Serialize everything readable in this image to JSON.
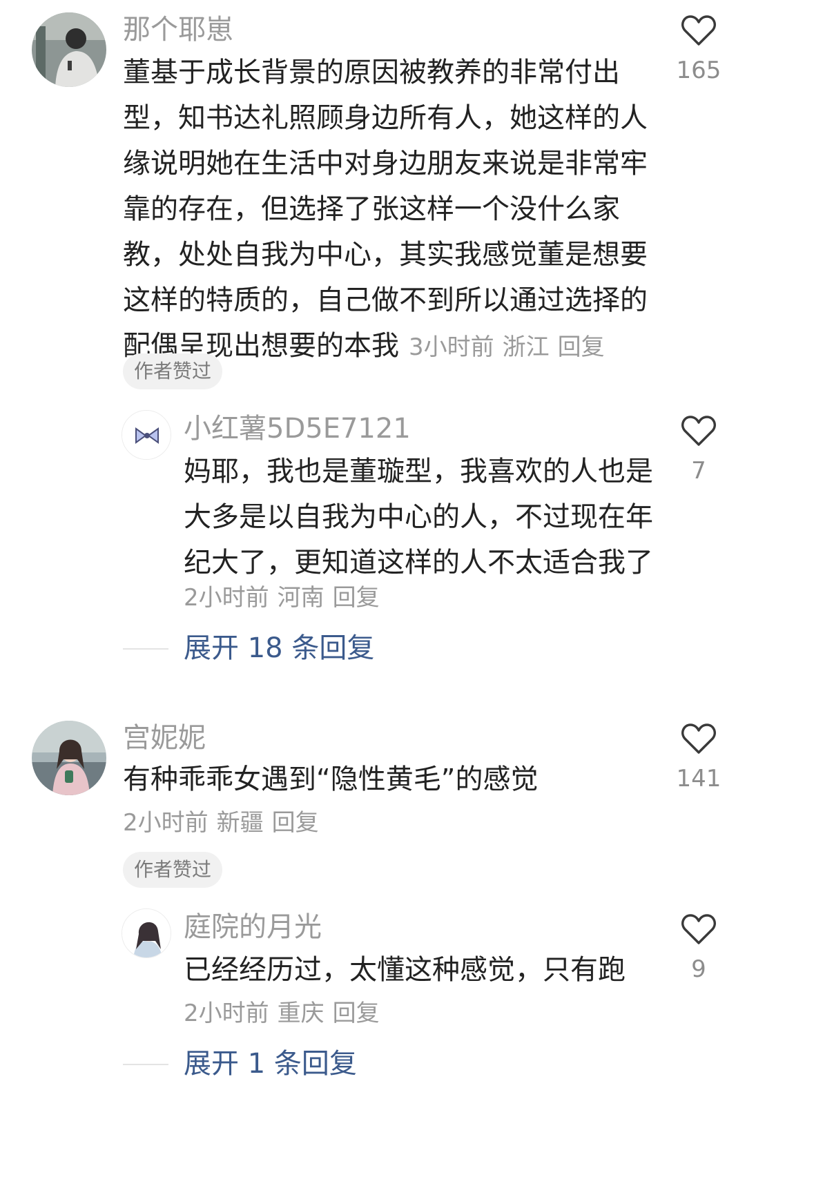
{
  "comments": [
    {
      "username": "那个耶崽",
      "avatar": "user-photo-avatar",
      "text_lines": [
        "董基于成长背景的原因被教养的非常付出",
        "型，知书达礼照顾身边所有人，她这样的人",
        "缘说明她在生活中对身边朋友来说是非常牢",
        "靠的存在，但选择了张这样一个没什么家",
        "教，处处自我为中心，其实我感觉董是想要",
        "这样的特质的，自己做不到所以通过选择的",
        "配偶呈现出想要的本我"
      ],
      "time": "3小时前",
      "location": "浙江",
      "reply_label": "回复",
      "likes": "165",
      "author_liked": "作者赞过",
      "reply": {
        "username": "小红薯5D5E7121",
        "avatar": "bow-avatar",
        "text_lines": [
          "妈耶，我也是董璇型，我喜欢的人也是",
          "大多是以自我为中心的人，不过现在年",
          "纪大了，更知道这样的人不太适合我了"
        ],
        "time": "2小时前",
        "location": "河南",
        "reply_label": "回复",
        "likes": "7"
      },
      "expand_label": "展开 18 条回复"
    },
    {
      "username": "宫妮妮",
      "avatar": "girl-photo-avatar",
      "text_lines": [
        "有种乖乖女遇到“隐性黄毛”的感觉"
      ],
      "time": "2小时前",
      "location": "新疆",
      "reply_label": "回复",
      "likes": "141",
      "author_liked": "作者赞过",
      "reply": {
        "username": "庭院的月光",
        "avatar": "illustrated-girl-avatar",
        "text_lines": [
          "已经经历过，太懂这种感觉，只有跑"
        ],
        "time": "2小时前",
        "location": "重庆",
        "reply_label": "回复",
        "likes": "9"
      },
      "expand_label": "展开 1 条回复"
    }
  ],
  "colors": {
    "text": "#222222",
    "meta": "#9a9a9a",
    "link": "#3b5a8c",
    "badge_bg": "#f1f1f1"
  },
  "icons": [
    "heart-outline-icon"
  ]
}
